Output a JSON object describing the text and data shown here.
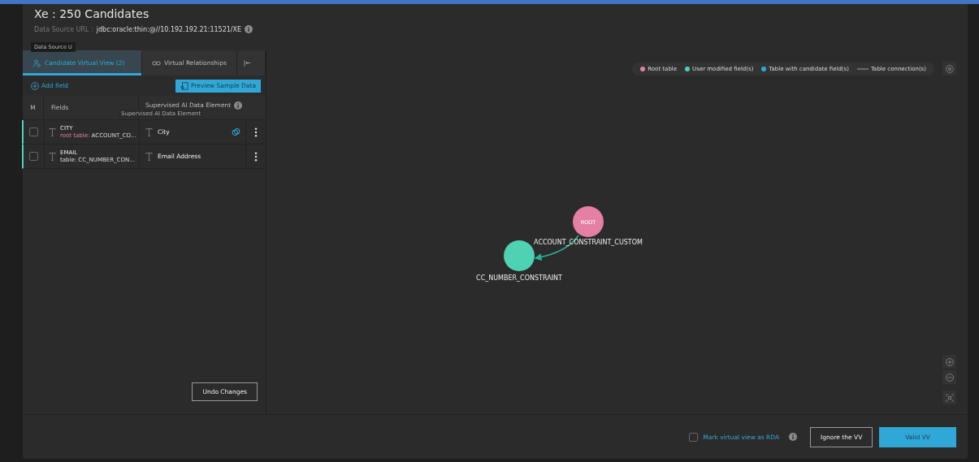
{
  "header": {
    "title": "Xe : 250 Candidates",
    "url_label": "Data Source URL :",
    "url": "jdbc:oracle:thin:@//10.192.192.21:11521/XE",
    "tooltip": "Data Source U"
  },
  "tabs": [
    {
      "label": "Candidate Virtual View (2)",
      "selected": true
    },
    {
      "label": "Virtual Relationships",
      "selected": false
    }
  ],
  "collapse": "|←",
  "toolbar": {
    "add": "Add field",
    "preview": "Preview Sample Data"
  },
  "table": {
    "columns": [
      "M",
      "Fields",
      "Supervised AI Data Element"
    ],
    "column_tooltip": "Supervised AI Data Element",
    "rows": [
      {
        "checked": false,
        "field": "CITY",
        "table_prefix": "root table:",
        "root": true,
        "table": "ACCOUNT_CO...",
        "element": "City",
        "linked": true
      },
      {
        "checked": false,
        "field": "EMAIL",
        "table_prefix": "table:",
        "root": false,
        "table": "CC_NUMBER_CON...",
        "element": "Email Address",
        "linked": false
      }
    ]
  },
  "undo": "Undo Changes",
  "legend": [
    {
      "label": "Root table",
      "kind": "dot",
      "color": "#e57fa3"
    },
    {
      "label": "User modified field(s)",
      "kind": "dot",
      "color": "#4fd1b3"
    },
    {
      "label": "Table with candidate field(s)",
      "kind": "dot",
      "color": "#2fa8d8"
    },
    {
      "label": "Table connection(s)",
      "kind": "line",
      "color": "#6a6a6a"
    }
  ],
  "graph": {
    "nodes": [
      {
        "label": "ACCOUNT_CONSTRAINT_CUSTOM",
        "text": "ROOT",
        "color": "#e57fa3"
      },
      {
        "label": "CC_NUMBER_CONSTRAINT",
        "color": "#4fd1b3"
      }
    ]
  },
  "footer": {
    "rda_label": "Mark virtual view as RDA",
    "rda_checked": false,
    "ignore": "Ignore the VV",
    "valid": "Valid VV"
  }
}
